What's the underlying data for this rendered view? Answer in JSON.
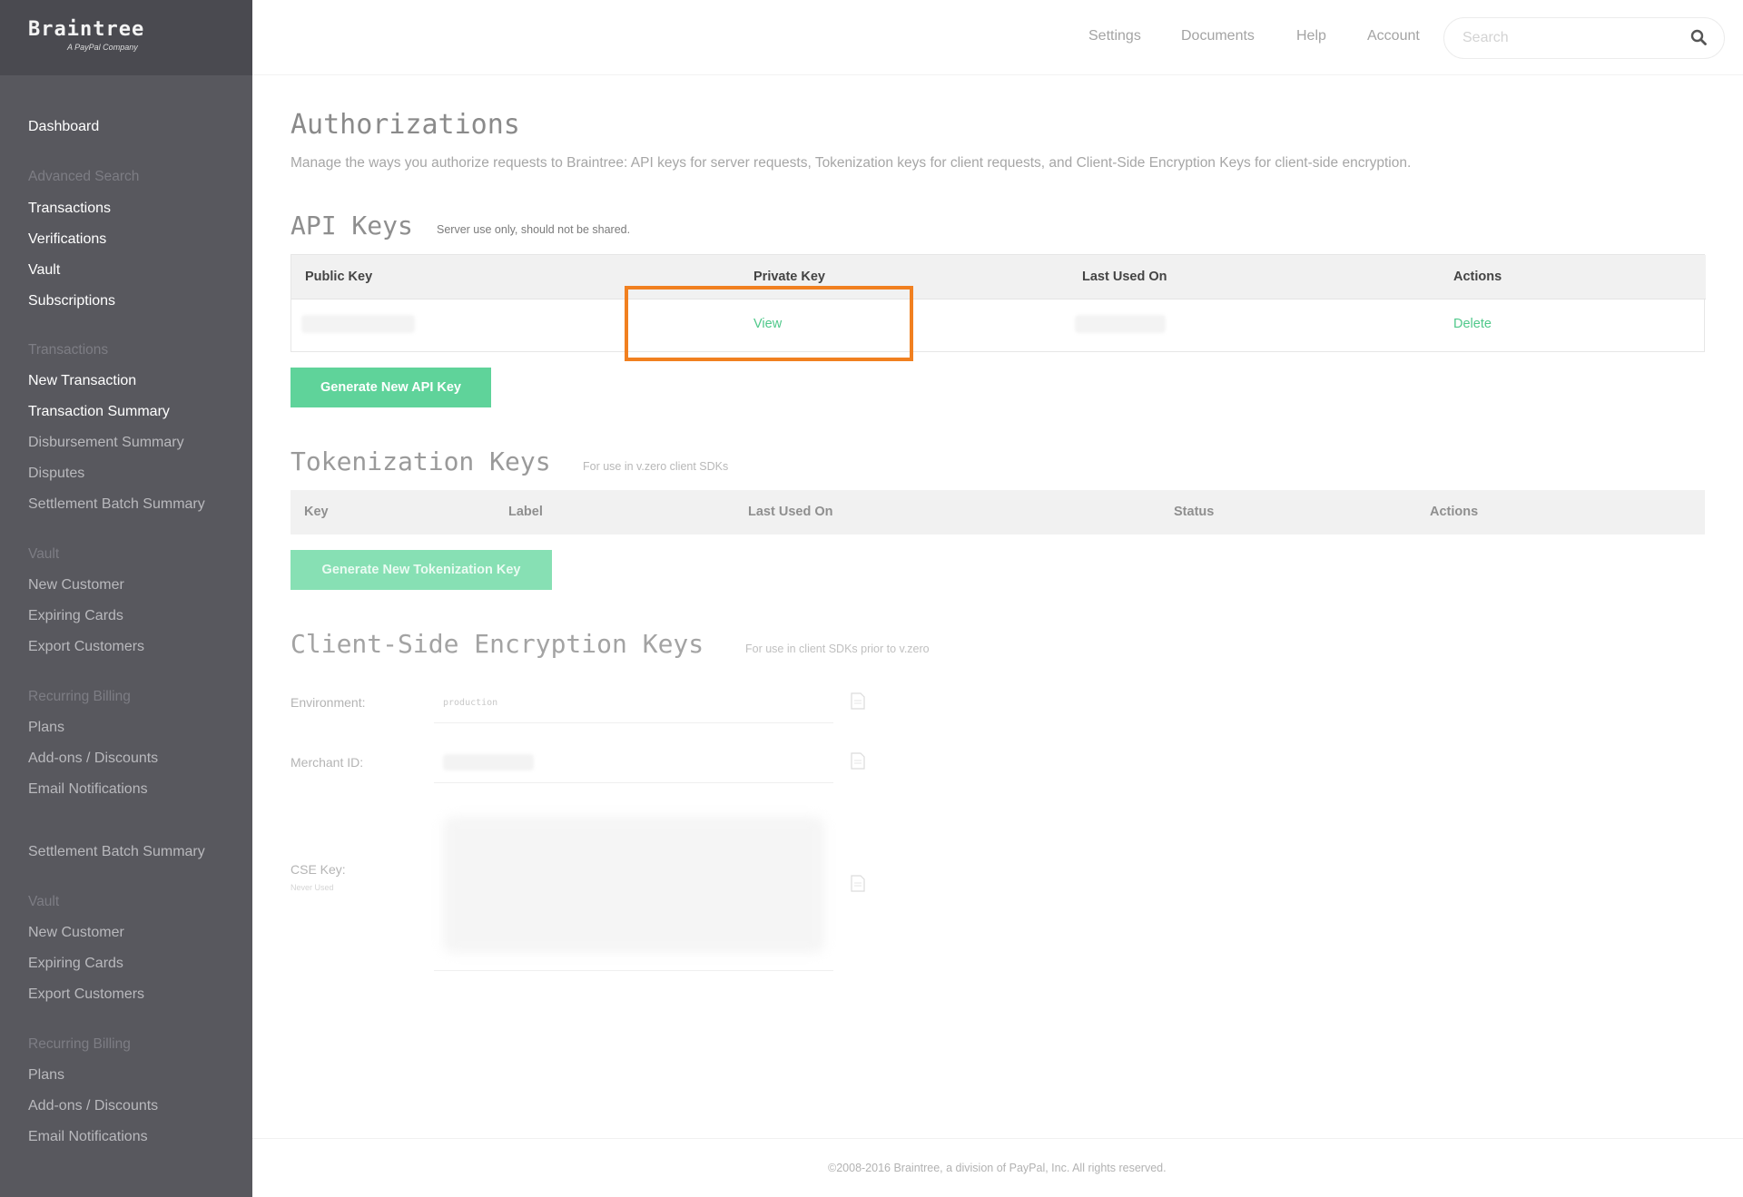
{
  "brand": {
    "name": "Braintree",
    "tagline": "A PayPal Company"
  },
  "topbar": {
    "links": [
      "Settings",
      "Documents",
      "Help",
      "Account"
    ],
    "search_placeholder": "Search"
  },
  "sidebar": {
    "dashboard": "Dashboard",
    "groups": [
      {
        "heading": "Advanced Search",
        "items": [
          "Transactions",
          "Verifications",
          "Vault",
          "Subscriptions"
        ]
      },
      {
        "heading": "Transactions",
        "items": [
          "New Transaction",
          "Transaction Summary",
          "Disbursement Summary",
          "Disputes",
          "Settlement Batch Summary"
        ]
      },
      {
        "heading": "Vault",
        "items": [
          "New Customer",
          "Expiring Cards",
          "Export Customers"
        ]
      },
      {
        "heading": "Recurring Billing",
        "items": [
          "Plans",
          "Add-ons / Discounts",
          "Email Notifications"
        ]
      }
    ],
    "repeat": {
      "item": "Settlement Batch Summary",
      "groups": [
        {
          "heading": "Vault",
          "items": [
            "New Customer",
            "Expiring Cards",
            "Export Customers"
          ]
        },
        {
          "heading": "Recurring Billing",
          "items": [
            "Plans",
            "Add-ons / Discounts",
            "Email Notifications"
          ]
        }
      ]
    }
  },
  "main": {
    "title": "Authorizations",
    "description": "Manage the ways you authorize requests to Braintree: API keys for server requests, Tokenization keys for client requests, and Client-Side Encryption Keys for client-side encryption.",
    "api_keys": {
      "title": "API Keys",
      "note": "Server use only, should not be shared.",
      "columns": [
        "Public Key",
        "Private Key",
        "Last Used On",
        "Actions"
      ],
      "row": {
        "private_key_action": "View",
        "action": "Delete"
      },
      "button": "Generate New API Key"
    },
    "tokenization_keys": {
      "title": "Tokenization Keys",
      "note": "For use in v.zero client SDKs",
      "columns": [
        "Key",
        "Label",
        "Last Used On",
        "Status",
        "Actions"
      ],
      "button": "Generate New Tokenization Key"
    },
    "cse_keys": {
      "title": "Client-Side Encryption Keys",
      "note": "For use in client SDKs prior to v.zero",
      "environment_label": "Environment:",
      "environment_value": "production",
      "merchant_label": "Merchant ID:",
      "cse_label": "CSE Key:",
      "cse_note": "Never Used"
    }
  },
  "footer": "©2008-2016 Braintree, a division of PayPal, Inc. All rights reserved.",
  "colors": {
    "accent": "#4fc88a",
    "button": "#5fd39a",
    "highlight": "#f18020",
    "sidebar": "#58585e"
  }
}
